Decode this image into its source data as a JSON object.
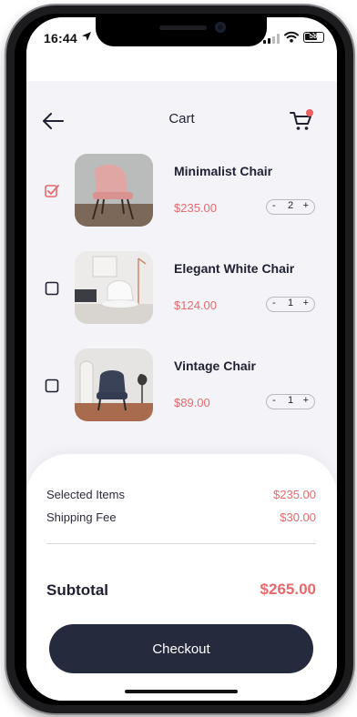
{
  "status_bar": {
    "time": "16:44",
    "battery": "58"
  },
  "header": {
    "title": "Cart"
  },
  "items": [
    {
      "name": "Minimalist Chair",
      "price": "$235.00",
      "quantity": "2",
      "checked": true
    },
    {
      "name": "Elegant White Chair",
      "price": "$124.00",
      "quantity": "1",
      "checked": false
    },
    {
      "name": "Vintage Chair",
      "price": "$89.00",
      "quantity": "1",
      "checked": false
    }
  ],
  "stepper": {
    "minus": "-",
    "plus": "+"
  },
  "summary": {
    "selected_label": "Selected Items",
    "selected_value": "$235.00",
    "shipping_label": "Shipping Fee",
    "shipping_value": "$30.00",
    "subtotal_label": "Subtotal",
    "subtotal_value": "$265.00"
  },
  "checkout_label": "Checkout",
  "icons": [
    "back-arrow-icon",
    "cart-icon",
    "checkbox-checked-icon",
    "checkbox-unchecked-icon",
    "location-arrow-icon",
    "signal-icon",
    "wifi-icon",
    "battery-icon"
  ],
  "colors": {
    "accent": "#e76a6e",
    "dark": "#262a3d",
    "background": "#f4f3f8"
  }
}
